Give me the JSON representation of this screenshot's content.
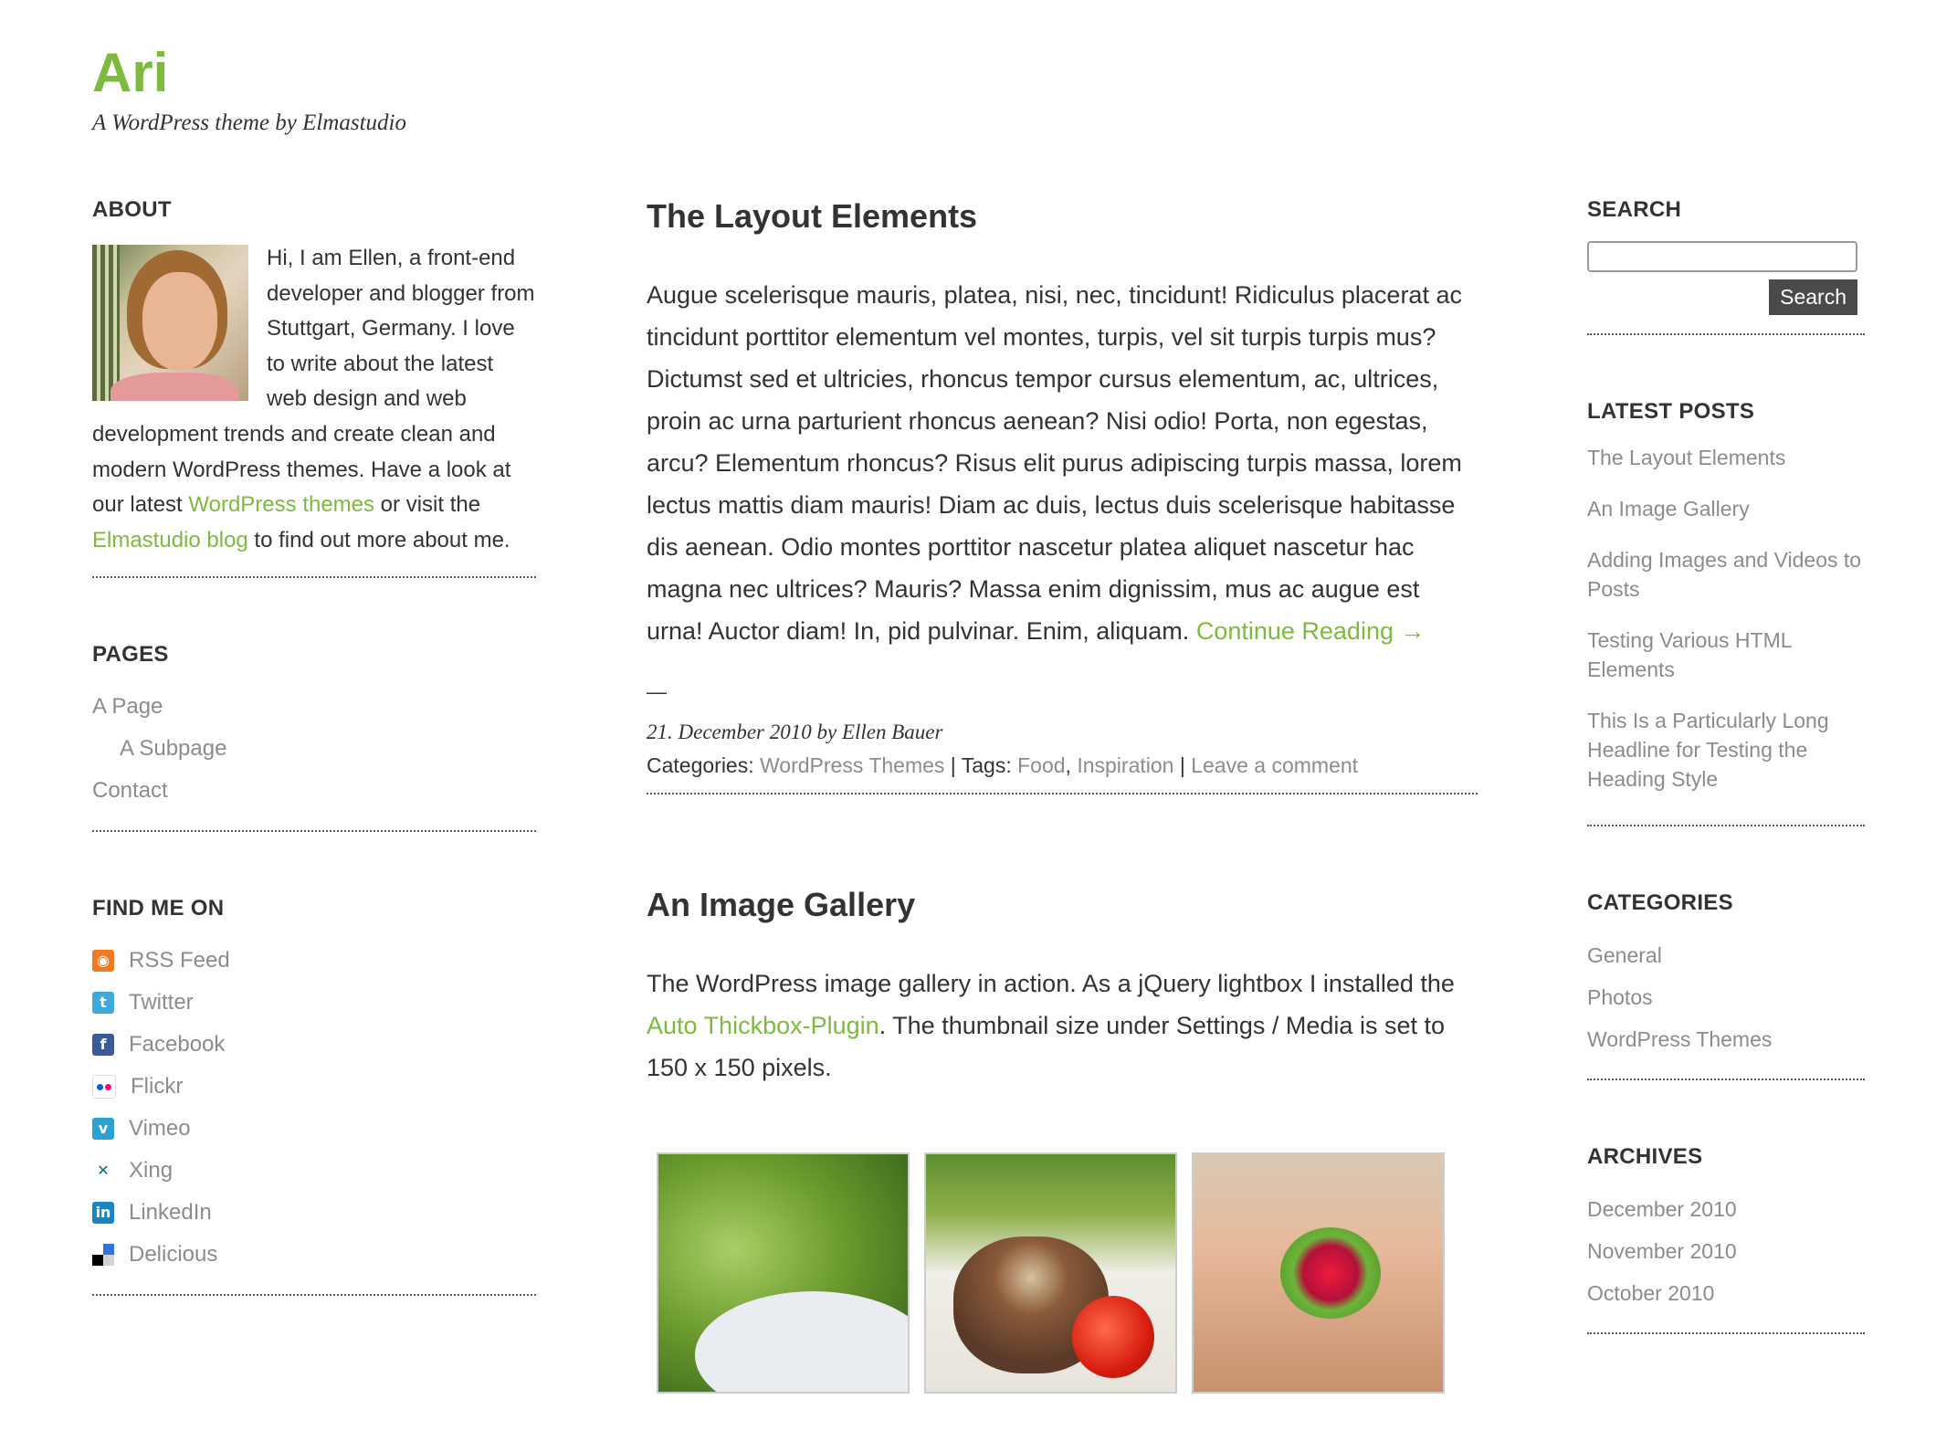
{
  "site": {
    "title": "Ari",
    "tagline": "A WordPress theme by Elmastudio",
    "accent_color": "#7dbb3e"
  },
  "about": {
    "heading": "About",
    "text_1": "Hi, I am Ellen, a front-end developer and blogger from Stuttgart, Germany. I love to write about the latest web design and web development trends and create clean and modern WordPress themes. Have a look at our latest ",
    "link_1": "WordPress themes",
    "text_2": " or visit the ",
    "link_2": "Elmastudio blog",
    "text_3": " to find out more about me."
  },
  "pages": {
    "heading": "Pages",
    "items": [
      "A Page",
      "A Subpage",
      "Contact"
    ]
  },
  "find_me": {
    "heading": "Find me on",
    "items": [
      {
        "label": "RSS Feed",
        "icon": "rss-icon"
      },
      {
        "label": "Twitter",
        "icon": "twitter-icon"
      },
      {
        "label": "Facebook",
        "icon": "facebook-icon"
      },
      {
        "label": "Flickr",
        "icon": "flickr-icon"
      },
      {
        "label": "Vimeo",
        "icon": "vimeo-icon"
      },
      {
        "label": "Xing",
        "icon": "xing-icon"
      },
      {
        "label": "LinkedIn",
        "icon": "linkedin-icon"
      },
      {
        "label": "Delicious",
        "icon": "delicious-icon"
      }
    ]
  },
  "posts": [
    {
      "title": "The Layout Elements",
      "body": "Augue scelerisque mauris, platea, nisi, nec, tincidunt! Ridiculus placerat ac tincidunt porttitor elementum vel montes, turpis, vel sit turpis turpis mus? Dictumst sed et ultricies, rhoncus tempor cursus elementum, ac, ultrices, proin ac urna parturient rhoncus aenean? Nisi odio! Porta, non egestas, arcu? Elementum rhoncus? Risus elit purus adipiscing turpis massa, lorem lectus mattis diam mauris! Diam ac duis, lectus duis scelerisque habitasse dis aenean. Odio montes porttitor nascetur platea aliquet nascetur hac magna nec ultrices? Mauris? Massa enim dignissim, mus ac augue est urna! Auctor diam! In, pid pulvinar. Enim, aliquam. ",
      "continue_link": "Continue Reading →",
      "separator": "—",
      "date_line": "21. December 2010 by Ellen Bauer",
      "categories_label": "Categories: ",
      "category": "WordPress Themes",
      "tags_label": " | Tags: ",
      "tag_1": "Food",
      "tag_sep": ", ",
      "tag_2": "Inspiration",
      "comment_sep": " | ",
      "comment_link": "Leave a comment"
    },
    {
      "title": "An Image Gallery",
      "body_1": "The WordPress image gallery in action. As a jQuery lightbox I installed the ",
      "link": "Auto Thickbox-Plugin",
      "body_2": ". The thumbnail size under Settings / Media is set to 150 x 150 pixels."
    }
  ],
  "search": {
    "heading": "Search",
    "value": "",
    "button_label": "Search"
  },
  "latest_posts": {
    "heading": "Latest Posts",
    "items": [
      "The Layout Elements",
      "An Image Gallery",
      "Adding Images and Videos to Posts",
      "Testing Various HTML Elements",
      "This Is a Particularly Long Headline for Testing the Heading Style"
    ]
  },
  "categories": {
    "heading": "Categories",
    "items": [
      "General",
      "Photos",
      "WordPress Themes"
    ]
  },
  "archives": {
    "heading": "Archives",
    "items": [
      "December 2010",
      "November 2010",
      "October 2010"
    ]
  }
}
